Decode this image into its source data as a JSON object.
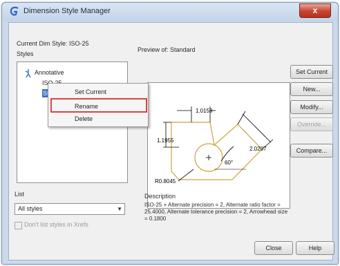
{
  "window": {
    "title": "Dimension Style Manager",
    "close_glyph": "x"
  },
  "current_style_label": "Current Dim Style: ISO-25",
  "styles_label": "Styles",
  "styles": [
    {
      "label": "Annotative",
      "icon": "annotative-icon"
    },
    {
      "label": "ISO-25"
    },
    {
      "label": "Standard",
      "selected": true
    }
  ],
  "context_menu": {
    "items": [
      "Set Current",
      "Rename",
      "Delete"
    ],
    "highlighted": "Rename",
    "highlight_color": "#e0413e"
  },
  "list_label": "List",
  "list_select": {
    "value": "All styles"
  },
  "xref_checkbox": {
    "label": "Don't list styles in Xrefs",
    "checked": false
  },
  "preview_label": "Preview of: Standard",
  "preview": {
    "dim_top": "1.0159",
    "dim_left": "1.1955",
    "dim_slant": "2.0207",
    "angle": "60°",
    "radius": "R0.8045"
  },
  "buttons": {
    "set_current": "Set Current",
    "new": "New...",
    "modify": "Modify...",
    "override": "Override...",
    "compare": "Compare...",
    "close": "Close",
    "help": "Help"
  },
  "description_label": "Description",
  "description_text": "ISO-25 + Alternate precision = 2, Alternate ratio factor = 25.4000, Alternate tolerance precision = 2, Arrowhead size = 0.1800",
  "colors": {
    "selection": "#3b73c5",
    "preview_lines": "#c9a53b",
    "dim_lines": "#000000"
  }
}
